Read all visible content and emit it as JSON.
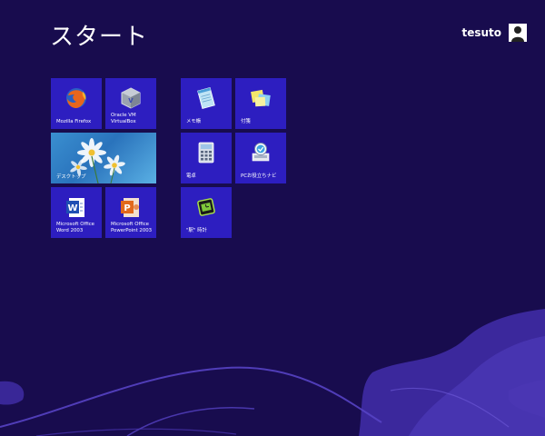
{
  "screen": {
    "title": "スタート",
    "background_color": "#180c4e",
    "tile_color": "#2d1ec0"
  },
  "user": {
    "name": "tesuto",
    "avatar_icon": "user-silhouette-icon"
  },
  "tiles": {
    "firefox": {
      "label": "Mozilla Firefox",
      "icon": "firefox-icon"
    },
    "virtualbox": {
      "label": "Oracle VM\nVirtualBox",
      "icon": "virtualbox-icon"
    },
    "desktop": {
      "label": "デスクトップ",
      "icon": "desktop-daisy-image"
    },
    "word": {
      "label": "Microsoft Office\nWord 2003",
      "icon": "word-icon"
    },
    "powerpoint": {
      "label": "Microsoft Office\nPowerPoint 2003",
      "icon": "powerpoint-icon"
    },
    "notepad": {
      "label": "メモ帳",
      "icon": "notepad-icon"
    },
    "sticky_notes": {
      "label": "付箋",
      "icon": "sticky-notes-icon"
    },
    "calculator": {
      "label": "電卓",
      "icon": "calculator-icon"
    },
    "pc_tips": {
      "label": "PCお役立ちナビ",
      "icon": "pc-tips-icon"
    },
    "clock": {
      "label": "\"駅\" 時計",
      "icon": "clock-icon"
    }
  }
}
